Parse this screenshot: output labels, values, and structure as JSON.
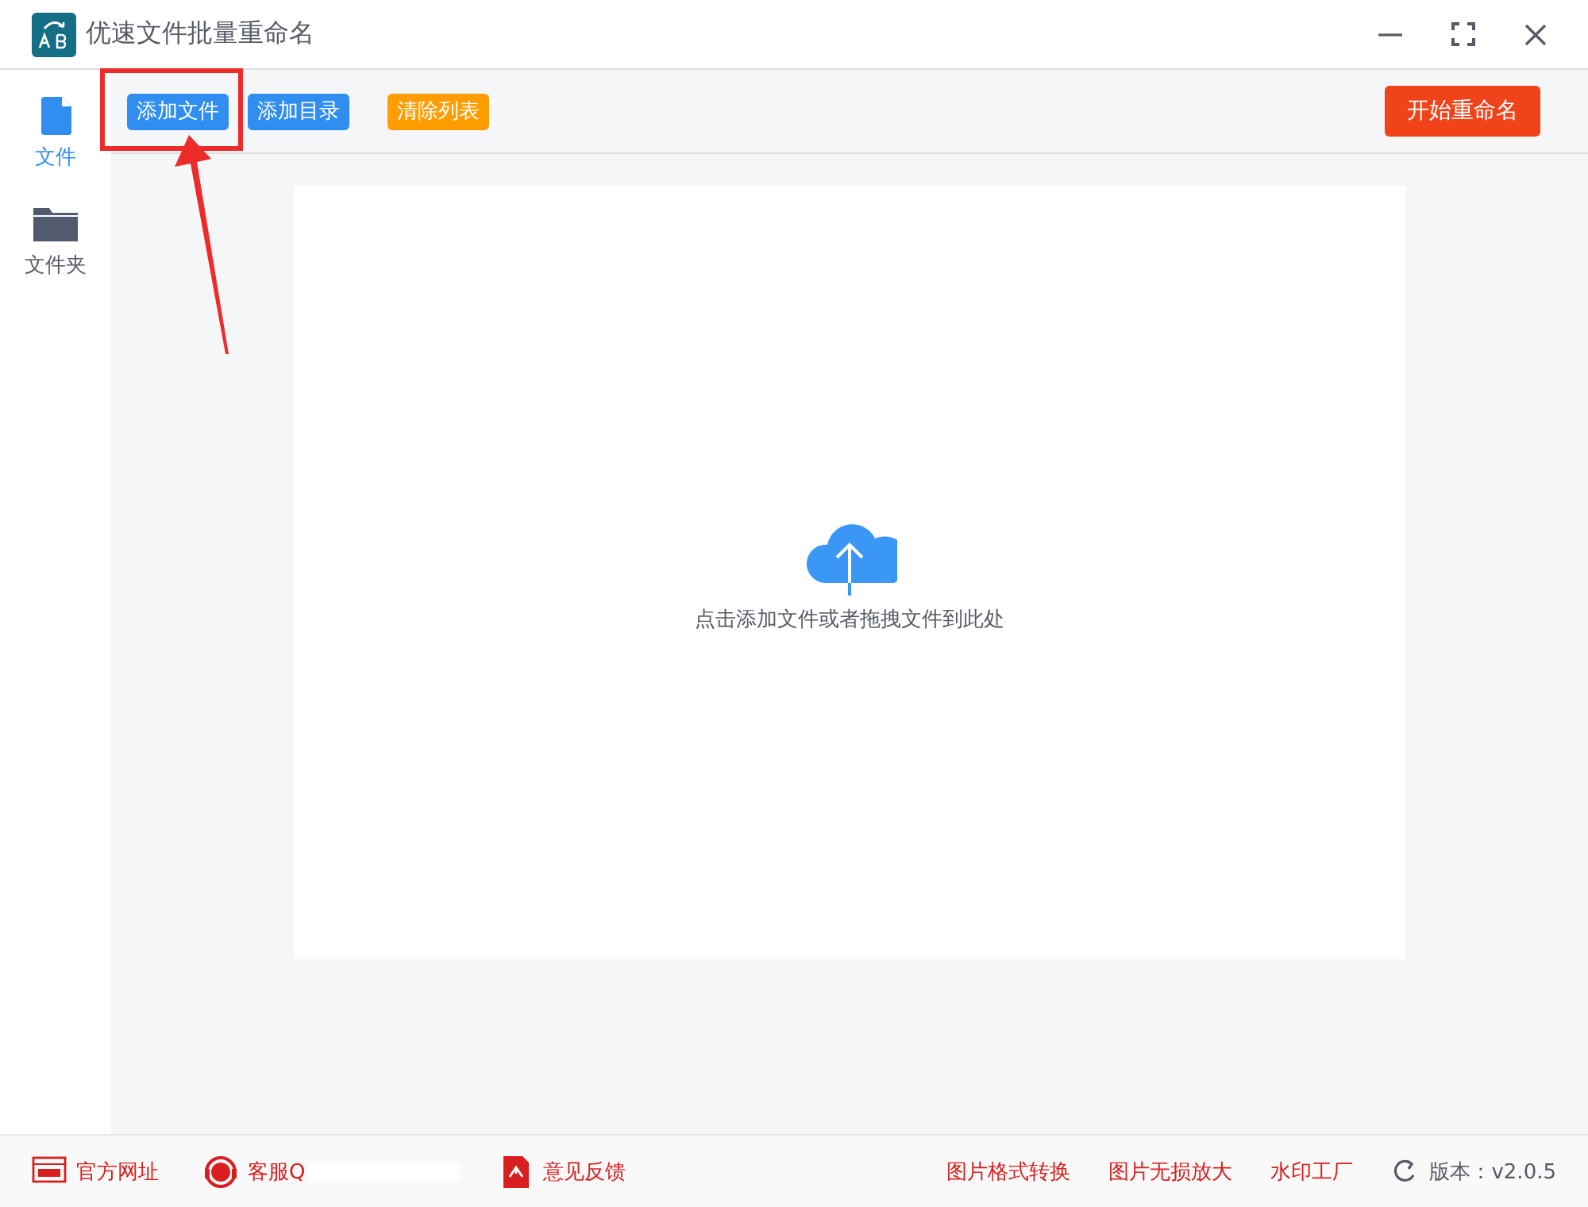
{
  "window": {
    "title": "优速文件批量重命名"
  },
  "toolbar": {
    "buttons": [
      {
        "label": "添加文件",
        "kind": "primary",
        "highlighted": true
      },
      {
        "label": "添加目录",
        "kind": "primary",
        "highlighted": false
      },
      {
        "label": "清除列表",
        "kind": "warning",
        "highlighted": false
      }
    ],
    "start_button": "开始重命名"
  },
  "sidebar": {
    "items": [
      {
        "label": "文件",
        "kind": "file",
        "selected": true
      },
      {
        "label": "文件夹",
        "kind": "folder",
        "selected": false
      }
    ]
  },
  "drop_zone": {
    "hint": "点击添加文件或者拖拽文件到此处"
  },
  "status_bar": {
    "links": [
      {
        "label": "官方网址",
        "kind": "web"
      },
      {
        "label": "客服Q",
        "kind": "support"
      },
      {
        "label": "意见反馈",
        "kind": "feedback"
      }
    ],
    "tools": [
      "图片格式转换",
      "图片无损放大",
      "水印工厂"
    ],
    "version": "版本：v2.0.5"
  }
}
